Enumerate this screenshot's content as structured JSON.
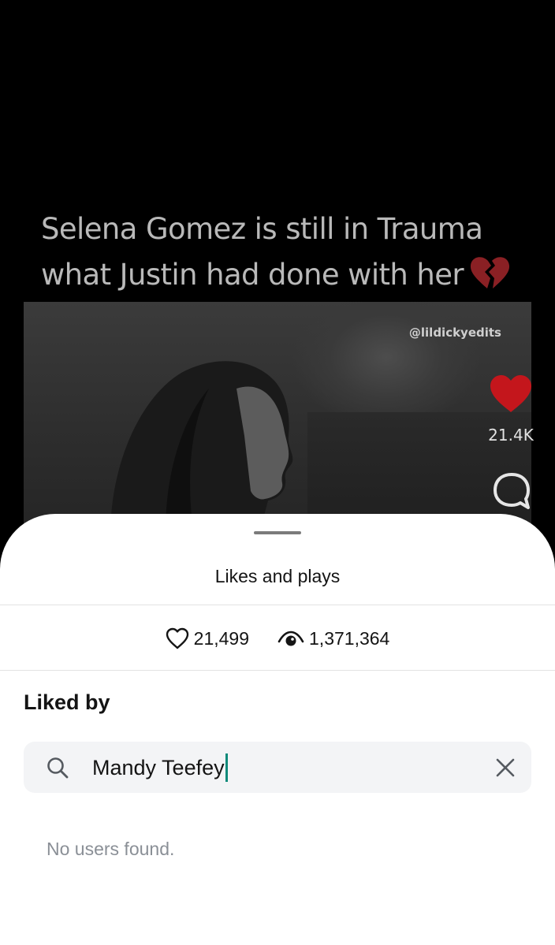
{
  "post": {
    "caption": "Selena Gomez is still in Trauma what Justin had done with her",
    "caption_emoji": "broken-heart-icon",
    "watermark": "@lildickyedits",
    "side_actions": {
      "like_count": "21.4K",
      "like_color": "#c4161c"
    }
  },
  "sheet": {
    "title": "Likes and plays",
    "stats": {
      "likes": "21,499",
      "plays": "1,371,364"
    },
    "section_title": "Liked by",
    "search": {
      "value": "Mandy Teefey",
      "caret_color": "#0d8a7a"
    },
    "empty_message": "No users found."
  }
}
